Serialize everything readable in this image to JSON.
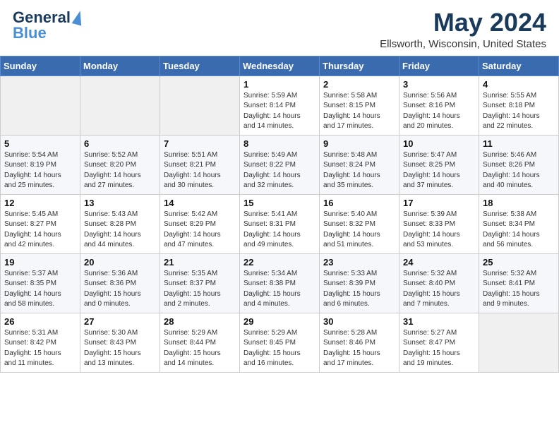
{
  "header": {
    "logo_line1": "General",
    "logo_line2": "Blue",
    "title": "May 2024",
    "subtitle": "Ellsworth, Wisconsin, United States"
  },
  "days_of_week": [
    "Sunday",
    "Monday",
    "Tuesday",
    "Wednesday",
    "Thursday",
    "Friday",
    "Saturday"
  ],
  "weeks": [
    [
      {
        "day": "",
        "info": ""
      },
      {
        "day": "",
        "info": ""
      },
      {
        "day": "",
        "info": ""
      },
      {
        "day": "1",
        "info": "Sunrise: 5:59 AM\nSunset: 8:14 PM\nDaylight: 14 hours\nand 14 minutes."
      },
      {
        "day": "2",
        "info": "Sunrise: 5:58 AM\nSunset: 8:15 PM\nDaylight: 14 hours\nand 17 minutes."
      },
      {
        "day": "3",
        "info": "Sunrise: 5:56 AM\nSunset: 8:16 PM\nDaylight: 14 hours\nand 20 minutes."
      },
      {
        "day": "4",
        "info": "Sunrise: 5:55 AM\nSunset: 8:18 PM\nDaylight: 14 hours\nand 22 minutes."
      }
    ],
    [
      {
        "day": "5",
        "info": "Sunrise: 5:54 AM\nSunset: 8:19 PM\nDaylight: 14 hours\nand 25 minutes."
      },
      {
        "day": "6",
        "info": "Sunrise: 5:52 AM\nSunset: 8:20 PM\nDaylight: 14 hours\nand 27 minutes."
      },
      {
        "day": "7",
        "info": "Sunrise: 5:51 AM\nSunset: 8:21 PM\nDaylight: 14 hours\nand 30 minutes."
      },
      {
        "day": "8",
        "info": "Sunrise: 5:49 AM\nSunset: 8:22 PM\nDaylight: 14 hours\nand 32 minutes."
      },
      {
        "day": "9",
        "info": "Sunrise: 5:48 AM\nSunset: 8:24 PM\nDaylight: 14 hours\nand 35 minutes."
      },
      {
        "day": "10",
        "info": "Sunrise: 5:47 AM\nSunset: 8:25 PM\nDaylight: 14 hours\nand 37 minutes."
      },
      {
        "day": "11",
        "info": "Sunrise: 5:46 AM\nSunset: 8:26 PM\nDaylight: 14 hours\nand 40 minutes."
      }
    ],
    [
      {
        "day": "12",
        "info": "Sunrise: 5:45 AM\nSunset: 8:27 PM\nDaylight: 14 hours\nand 42 minutes."
      },
      {
        "day": "13",
        "info": "Sunrise: 5:43 AM\nSunset: 8:28 PM\nDaylight: 14 hours\nand 44 minutes."
      },
      {
        "day": "14",
        "info": "Sunrise: 5:42 AM\nSunset: 8:29 PM\nDaylight: 14 hours\nand 47 minutes."
      },
      {
        "day": "15",
        "info": "Sunrise: 5:41 AM\nSunset: 8:31 PM\nDaylight: 14 hours\nand 49 minutes."
      },
      {
        "day": "16",
        "info": "Sunrise: 5:40 AM\nSunset: 8:32 PM\nDaylight: 14 hours\nand 51 minutes."
      },
      {
        "day": "17",
        "info": "Sunrise: 5:39 AM\nSunset: 8:33 PM\nDaylight: 14 hours\nand 53 minutes."
      },
      {
        "day": "18",
        "info": "Sunrise: 5:38 AM\nSunset: 8:34 PM\nDaylight: 14 hours\nand 56 minutes."
      }
    ],
    [
      {
        "day": "19",
        "info": "Sunrise: 5:37 AM\nSunset: 8:35 PM\nDaylight: 14 hours\nand 58 minutes."
      },
      {
        "day": "20",
        "info": "Sunrise: 5:36 AM\nSunset: 8:36 PM\nDaylight: 15 hours\nand 0 minutes."
      },
      {
        "day": "21",
        "info": "Sunrise: 5:35 AM\nSunset: 8:37 PM\nDaylight: 15 hours\nand 2 minutes."
      },
      {
        "day": "22",
        "info": "Sunrise: 5:34 AM\nSunset: 8:38 PM\nDaylight: 15 hours\nand 4 minutes."
      },
      {
        "day": "23",
        "info": "Sunrise: 5:33 AM\nSunset: 8:39 PM\nDaylight: 15 hours\nand 6 minutes."
      },
      {
        "day": "24",
        "info": "Sunrise: 5:32 AM\nSunset: 8:40 PM\nDaylight: 15 hours\nand 7 minutes."
      },
      {
        "day": "25",
        "info": "Sunrise: 5:32 AM\nSunset: 8:41 PM\nDaylight: 15 hours\nand 9 minutes."
      }
    ],
    [
      {
        "day": "26",
        "info": "Sunrise: 5:31 AM\nSunset: 8:42 PM\nDaylight: 15 hours\nand 11 minutes."
      },
      {
        "day": "27",
        "info": "Sunrise: 5:30 AM\nSunset: 8:43 PM\nDaylight: 15 hours\nand 13 minutes."
      },
      {
        "day": "28",
        "info": "Sunrise: 5:29 AM\nSunset: 8:44 PM\nDaylight: 15 hours\nand 14 minutes."
      },
      {
        "day": "29",
        "info": "Sunrise: 5:29 AM\nSunset: 8:45 PM\nDaylight: 15 hours\nand 16 minutes."
      },
      {
        "day": "30",
        "info": "Sunrise: 5:28 AM\nSunset: 8:46 PM\nDaylight: 15 hours\nand 17 minutes."
      },
      {
        "day": "31",
        "info": "Sunrise: 5:27 AM\nSunset: 8:47 PM\nDaylight: 15 hours\nand 19 minutes."
      },
      {
        "day": "",
        "info": ""
      }
    ]
  ]
}
